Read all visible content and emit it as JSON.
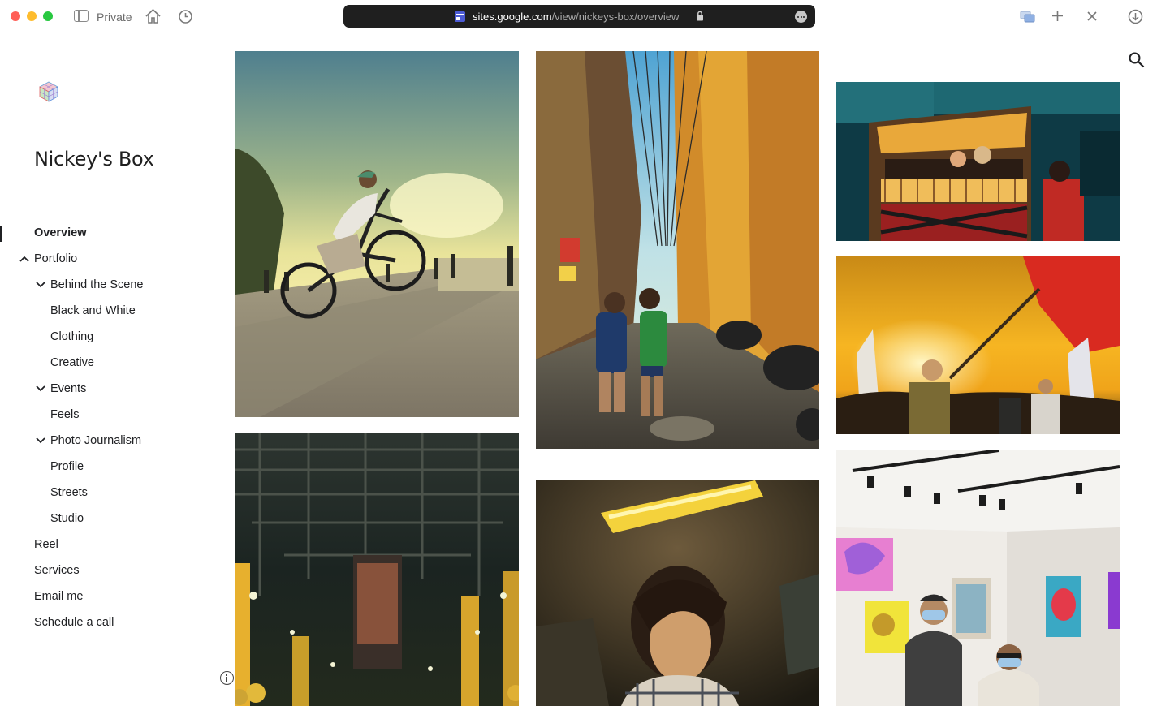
{
  "browser": {
    "private_label": "Private",
    "url_domain": "sites.google.com",
    "url_path": "/view/nickeys-box/overview"
  },
  "site": {
    "title": "Nickey's Box"
  },
  "nav": {
    "items": [
      {
        "label": "Overview"
      },
      {
        "label": "Portfolio"
      },
      {
        "label": "Behind the Scene"
      },
      {
        "label": "Black and White"
      },
      {
        "label": "Clothing"
      },
      {
        "label": "Creative"
      },
      {
        "label": "Events"
      },
      {
        "label": "Feels"
      },
      {
        "label": "Photo Journalism"
      },
      {
        "label": "Profile"
      },
      {
        "label": "Streets"
      },
      {
        "label": "Studio"
      },
      {
        "label": "Reel"
      },
      {
        "label": "Services"
      },
      {
        "label": "Email me"
      },
      {
        "label": "Schedule a call"
      }
    ]
  },
  "gallery": {
    "photos": [
      {
        "subject": "bmx-rider-sunset"
      },
      {
        "subject": "kids-in-alley"
      },
      {
        "subject": "jeepney-night"
      },
      {
        "subject": "protest-flag-sunset"
      },
      {
        "subject": "market-alley-night"
      },
      {
        "subject": "portrait-warm-light"
      },
      {
        "subject": "art-gallery-visitors"
      }
    ]
  }
}
